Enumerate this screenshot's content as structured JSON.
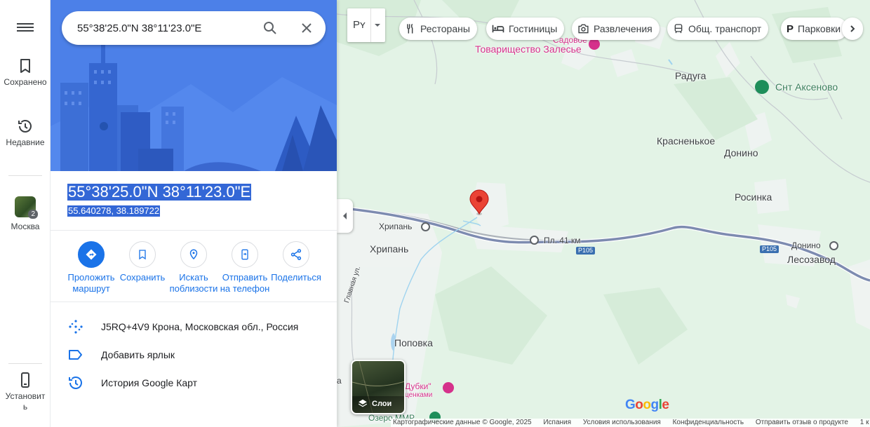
{
  "rail": {
    "saved_label": "Сохранено",
    "recent_label": "Недавние",
    "recent_place_label": "Москва",
    "recent_place_count": "2",
    "install_label": "Установить"
  },
  "search": {
    "value": "55°38'25.0\"N 38°11'23.0\"E"
  },
  "place": {
    "title": "55°38'25.0\"N 38°11'23.0\"E",
    "decimal": "55.640278, 38.189722"
  },
  "actions": [
    {
      "label": "Проложить маршрут",
      "icon": "directions-icon"
    },
    {
      "label": "Сохранить",
      "icon": "bookmark-icon"
    },
    {
      "label": "Искать поблизости",
      "icon": "nearby-icon"
    },
    {
      "label": "Отправить на телефон",
      "icon": "send-to-phone-icon"
    },
    {
      "label": "Поделиться",
      "icon": "share-icon"
    }
  ],
  "info": [
    {
      "text": "J5RQ+4V9 Крона, Московская обл., Россия",
      "icon": "plus-code-icon"
    },
    {
      "text": "Добавить ярлык",
      "icon": "label-icon"
    },
    {
      "text": "История Google Карт",
      "icon": "history-icon"
    }
  ],
  "map": {
    "lang_button": "Рʏ",
    "chips": [
      {
        "label": "Рестораны",
        "icon": "restaurant-icon"
      },
      {
        "label": "Гостиницы",
        "icon": "hotel-icon"
      },
      {
        "label": "Развлечения",
        "icon": "camera-icon"
      },
      {
        "label": "Общ. транспорт",
        "icon": "transit-icon"
      },
      {
        "label": "Парковки",
        "icon": "parking-icon"
      }
    ],
    "labels": {
      "sadovoe": "Садовое",
      "tovarishchestvo": "Товарищество Залесье",
      "raduga": "Радуга",
      "snt_aksenovo": "Снт Аксеново",
      "krasnenkoe": "Красненькое",
      "donino": "Донино",
      "rosinka": "Росинка",
      "khripan_station": "Хрипань",
      "khripan": "Хрипань",
      "pl41": "Пл. 41 км",
      "donino_station": "Донино",
      "lesozavod": "Лесозавод",
      "glavnaya": "Главная ул.",
      "popovka": "Поповка",
      "dubki": "Дубки\"",
      "dubki2": "ценками",
      "ozero": "Озеро ММР",
      "partial_a": "а"
    },
    "road_shields": [
      "Р105",
      "Р105"
    ],
    "layers_label": "Слои",
    "footer": [
      "Картографические данные © Google, 2025",
      "Испания",
      "Условия использования",
      "Конфиденциальность",
      "Отправить отзыв о продукте",
      "1 к"
    ]
  },
  "colors": {
    "accent": "#1a73e8",
    "hero": "#4c80e8",
    "pin": "#ea4335",
    "map_green": "#e3f3e6",
    "road": "#7d8bb0",
    "poi_pink": "#d5318b"
  }
}
